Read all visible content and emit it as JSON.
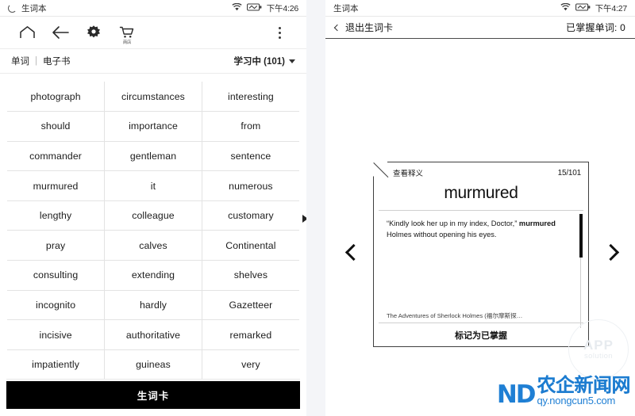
{
  "left": {
    "statusbar": {
      "sync_icon": "sync-icon",
      "title": "生词本",
      "wifi_icon": "wifi-icon",
      "battery_icon": "battery-icon",
      "time": "下午4:26"
    },
    "toolbar": {
      "home_icon": "home-icon",
      "back_icon": "back-arrow-icon",
      "settings_icon": "gear-icon",
      "store_icon": "shopping-cart-icon",
      "store_label": "商店",
      "overflow_icon": "kebab-menu-icon"
    },
    "tabs": {
      "word_tab": "单词",
      "separator": "|",
      "ebook_tab": "电子书",
      "filter_label": "学习中 (101)",
      "filter_caret": "chevron-down-icon"
    },
    "word_grid": {
      "rows": [
        [
          "photograph",
          "circumstances",
          "interesting"
        ],
        [
          "should",
          "importance",
          "from"
        ],
        [
          "commander",
          "gentleman",
          "sentence"
        ],
        [
          "murmured",
          "it",
          "numerous"
        ],
        [
          "lengthy",
          "colleague",
          "customary"
        ],
        [
          "pray",
          "calves",
          "Continental"
        ],
        [
          "consulting",
          "extending",
          "shelves"
        ],
        [
          "incognito",
          "hardly",
          "Gazetteer"
        ],
        [
          "incisive",
          "authoritative",
          "remarked"
        ],
        [
          "impatiently",
          "guineas",
          "very"
        ]
      ],
      "next_page_icon": "next-page-triangle-icon"
    },
    "cta_label": "生词卡"
  },
  "right": {
    "statusbar": {
      "title": "生词本",
      "wifi_icon": "wifi-icon",
      "battery_icon": "battery-icon",
      "time": "下午4:27"
    },
    "navbar": {
      "back_icon": "chevron-left-icon",
      "back_label": "退出生词卡",
      "mastered_label": "已掌握单词: 0"
    },
    "flashcard": {
      "definition_link": "查看释义",
      "counter": "15/101",
      "word": "murmured",
      "sentence_pre": "“Kindly look her up in my index, Doctor,”",
      "sentence_bold": "murmured",
      "sentence_post": "Holmes without opening his eyes.",
      "source": "The Adventures of Sherlock Holmes (福尔摩斯探…",
      "mark_button": "标记为已掌握",
      "fold_icon": "page-fold-icon",
      "scrollbar_icon": "vertical-scrollbar"
    },
    "prev_icon": "chevron-left-large-icon",
    "next_icon": "chevron-right-large-icon"
  },
  "watermark": {
    "app_line1": "APP",
    "app_line2": "solution",
    "logo_mark": "ND",
    "logo_cn": "农企新闻网",
    "logo_url": "qy.nongcun5.com",
    "brand_color": "#1f7fd4"
  }
}
